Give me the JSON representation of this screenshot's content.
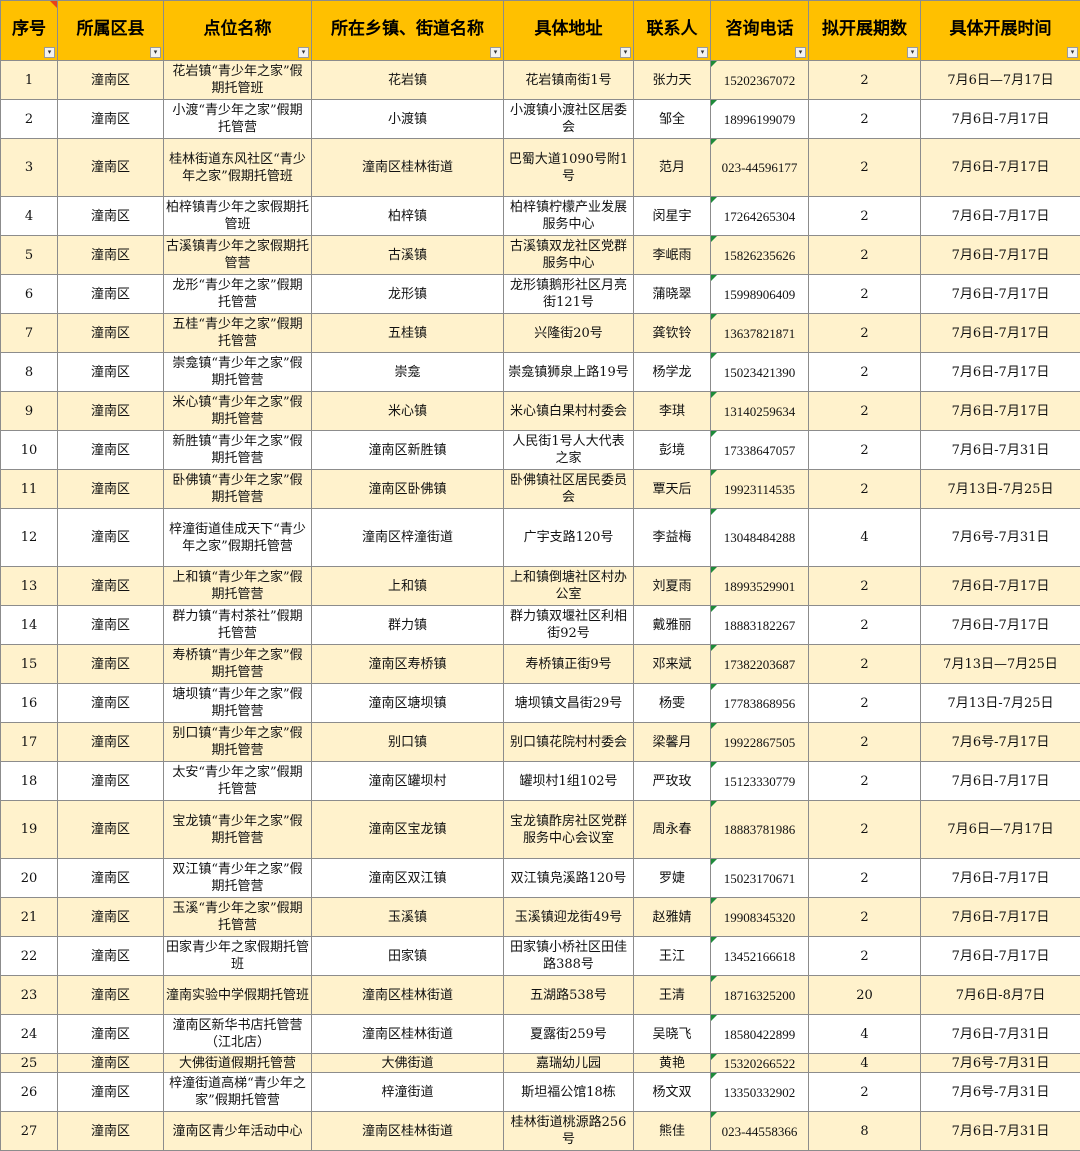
{
  "columns": [
    "序号",
    "所属区县",
    "点位名称",
    "所在乡镇、街道名称",
    "具体地址",
    "联系人",
    "咨询电话",
    "拟开展期数",
    "具体开展时间"
  ],
  "filter_glyph": "▾",
  "rows": [
    {
      "no": "1",
      "district": "潼南区",
      "name": "花岩镇“青少年之家”假期托管班",
      "town": "花岩镇",
      "address": "花岩镇南街1号",
      "contact": "张力天",
      "phone": "15202367072",
      "periods": "2",
      "time": "7月6日—7月17日"
    },
    {
      "no": "2",
      "district": "潼南区",
      "name": "小渡“青少年之家”假期托管营",
      "town": "小渡镇",
      "address": "小渡镇小渡社区居委会",
      "contact": "邹全",
      "phone": "18996199079",
      "periods": "2",
      "time": "7月6日-7月17日"
    },
    {
      "no": "3",
      "district": "潼南区",
      "name": "桂林街道东风社区“青少年之家”假期托管班",
      "town": "潼南区桂林街道",
      "address": "巴蜀大道1090号附1号",
      "contact": "范月",
      "phone": "023-44596177",
      "periods": "2",
      "time": "7月6日-7月17日"
    },
    {
      "no": "4",
      "district": "潼南区",
      "name": "柏梓镇青少年之家假期托管班",
      "town": "柏梓镇",
      "address": "柏梓镇柠檬产业发展服务中心",
      "contact": "闵星宇",
      "phone": "17264265304",
      "periods": "2",
      "time": "7月6日-7月17日"
    },
    {
      "no": "5",
      "district": "潼南区",
      "name": "古溪镇青少年之家假期托管营",
      "town": "古溪镇",
      "address": "古溪镇双龙社区党群服务中心",
      "contact": "李岷雨",
      "phone": "15826235626",
      "periods": "2",
      "time": "7月6日-7月17日"
    },
    {
      "no": "6",
      "district": "潼南区",
      "name": "龙形“青少年之家”假期托管营",
      "town": "龙形镇",
      "address": "龙形镇鹅形社区月亮街121号",
      "contact": "蒲晓翠",
      "phone": "15998906409",
      "periods": "2",
      "time": "7月6日-7月17日"
    },
    {
      "no": "7",
      "district": "潼南区",
      "name": "五桂“青少年之家”假期托管营",
      "town": "五桂镇",
      "address": "兴隆街20号",
      "contact": "龚钦铃",
      "phone": "13637821871",
      "periods": "2",
      "time": "7月6日-7月17日"
    },
    {
      "no": "8",
      "district": "潼南区",
      "name": "崇龛镇“青少年之家”假期托管营",
      "town": "崇龛",
      "address": "崇龛镇狮泉上路19号",
      "contact": "杨学龙",
      "phone": "15023421390",
      "periods": "2",
      "time": "7月6日-7月17日"
    },
    {
      "no": "9",
      "district": "潼南区",
      "name": "米心镇“青少年之家”假期托管营",
      "town": "米心镇",
      "address": "米心镇白果村村委会",
      "contact": "李琪",
      "phone": "13140259634",
      "periods": "2",
      "time": "7月6日-7月17日"
    },
    {
      "no": "10",
      "district": "潼南区",
      "name": "新胜镇“青少年之家”假期托管营",
      "town": "潼南区新胜镇",
      "address": "人民街1号人大代表之家",
      "contact": "彭境",
      "phone": "17338647057",
      "periods": "2",
      "time": "7月6日-7月31日"
    },
    {
      "no": "11",
      "district": "潼南区",
      "name": "卧佛镇“青少年之家”假期托管营",
      "town": "潼南区卧佛镇",
      "address": "卧佛镇社区居民委员会",
      "contact": "覃天后",
      "phone": "19923114535",
      "periods": "2",
      "time": "7月13日-7月25日"
    },
    {
      "no": "12",
      "district": "潼南区",
      "name": "梓潼街道佳成天下“青少年之家”假期托管营",
      "town": "潼南区梓潼街道",
      "address": "广宇支路120号",
      "contact": "李益梅",
      "phone": "13048484288",
      "periods": "4",
      "time": "7月6号-7月31日"
    },
    {
      "no": "13",
      "district": "潼南区",
      "name": "上和镇“青少年之家”假期托管营",
      "town": "上和镇",
      "address": "上和镇倒塘社区村办公室",
      "contact": "刘夏雨",
      "phone": "18993529901",
      "periods": "2",
      "time": "7月6日-7月17日"
    },
    {
      "no": "14",
      "district": "潼南区",
      "name": "群力镇“青村茶社”假期托管营",
      "town": "群力镇",
      "address": "群力镇双堰社区利相街92号",
      "contact": "戴雅丽",
      "phone": "18883182267",
      "periods": "2",
      "time": "7月6日-7月17日"
    },
    {
      "no": "15",
      "district": "潼南区",
      "name": "寿桥镇“青少年之家”假期托管营",
      "town": "潼南区寿桥镇",
      "address": "寿桥镇正街9号",
      "contact": "邓来斌",
      "phone": "17382203687",
      "periods": "2",
      "time": "7月13日—7月25日"
    },
    {
      "no": "16",
      "district": "潼南区",
      "name": "塘坝镇“青少年之家”假期托管营",
      "town": "潼南区塘坝镇",
      "address": "塘坝镇文昌街29号",
      "contact": "杨雯",
      "phone": "17783868956",
      "periods": "2",
      "time": "7月13日-7月25日"
    },
    {
      "no": "17",
      "district": "潼南区",
      "name": "别口镇“青少年之家”假期托管营",
      "town": "别口镇",
      "address": "别口镇花院村村委会",
      "contact": "梁馨月",
      "phone": "19922867505",
      "periods": "2",
      "time": "7月6号-7月17日"
    },
    {
      "no": "18",
      "district": "潼南区",
      "name": "太安“青少年之家”假期托管营",
      "town": "潼南区罐坝村",
      "address": "罐坝村1组102号",
      "contact": "严玫玫",
      "phone": "15123330779",
      "periods": "2",
      "time": "7月6日-7月17日"
    },
    {
      "no": "19",
      "district": "潼南区",
      "name": "宝龙镇“青少年之家”假期托管营",
      "town": "潼南区宝龙镇",
      "address": "宝龙镇酢房社区党群服务中心会议室",
      "contact": "周永春",
      "phone": "18883781986",
      "periods": "2",
      "time": "7月6日—7月17日"
    },
    {
      "no": "20",
      "district": "潼南区",
      "name": "双江镇“青少年之家”假期托管营",
      "town": "潼南区双江镇",
      "address": "双江镇凫溪路120号",
      "contact": "罗婕",
      "phone": "15023170671",
      "periods": "2",
      "time": "7月6日-7月17日"
    },
    {
      "no": "21",
      "district": "潼南区",
      "name": "玉溪“青少年之家”假期托管营",
      "town": "玉溪镇",
      "address": "玉溪镇迎龙街49号",
      "contact": "赵雅婧",
      "phone": "19908345320",
      "periods": "2",
      "time": "7月6日-7月17日"
    },
    {
      "no": "22",
      "district": "潼南区",
      "name": "田家青少年之家假期托管班",
      "town": "田家镇",
      "address": "田家镇小桥社区田佳路388号",
      "contact": "王江",
      "phone": "13452166618",
      "periods": "2",
      "time": "7月6日-7月17日"
    },
    {
      "no": "23",
      "district": "潼南区",
      "name": "潼南实验中学假期托管班",
      "town": "潼南区桂林街道",
      "address": "五湖路538号",
      "contact": "王清",
      "phone": "18716325200",
      "periods": "20",
      "time": "7月6日-8月7日"
    },
    {
      "no": "24",
      "district": "潼南区",
      "name": "潼南区新华书店托管营（江北店）",
      "town": "潼南区桂林街道",
      "address": "夏露街259号",
      "contact": "吴晓飞",
      "phone": "18580422899",
      "periods": "4",
      "time": "7月6日-7月31日"
    },
    {
      "no": "25",
      "district": "潼南区",
      "name": "大佛街道假期托管营",
      "town": "大佛街道",
      "address": "嘉瑞幼儿园",
      "contact": "黄艳",
      "phone": "15320266522",
      "periods": "4",
      "time": "7月6号-7月31日"
    },
    {
      "no": "26",
      "district": "潼南区",
      "name": "梓潼街道高梯“青少年之家”假期托管营",
      "town": "梓潼街道",
      "address": "斯坦福公馆18栋",
      "contact": "杨文双",
      "phone": "13350332902",
      "periods": "2",
      "time": "7月6号-7月31日"
    },
    {
      "no": "27",
      "district": "潼南区",
      "name": "潼南区青少年活动中心",
      "town": "潼南区桂林街道",
      "address": "桂林街道桃源路256号",
      "contact": "熊佳",
      "phone": "023-44558366",
      "periods": "8",
      "time": "7月6日-7月31日"
    }
  ]
}
